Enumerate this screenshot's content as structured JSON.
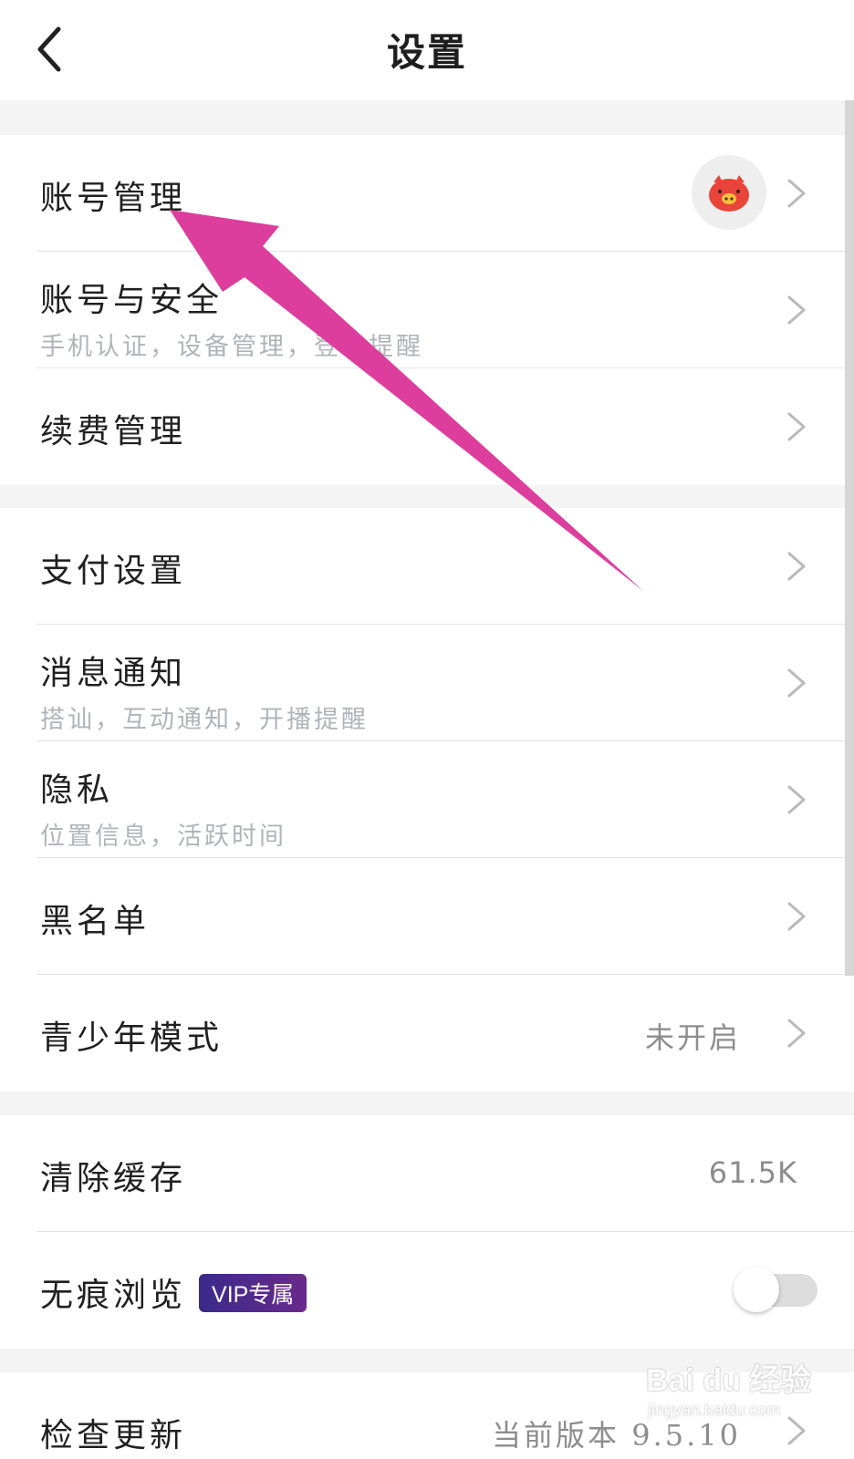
{
  "header": {
    "title": "设置"
  },
  "groups": [
    {
      "items": [
        {
          "title": "账号管理"
        },
        {
          "title": "账号与安全",
          "subtitle": "手机认证，设备管理，登录提醒"
        },
        {
          "title": "续费管理"
        }
      ]
    },
    {
      "items": [
        {
          "title": "支付设置"
        },
        {
          "title": "消息通知",
          "subtitle": "搭讪，互动通知，开播提醒"
        },
        {
          "title": "隐私",
          "subtitle": "位置信息，活跃时间"
        },
        {
          "title": "黑名单"
        },
        {
          "title": "青少年模式",
          "value": "未开启"
        }
      ]
    },
    {
      "items": [
        {
          "title": "清除缓存",
          "value": "61.5K"
        },
        {
          "title": "无痕浏览",
          "badge": "VIP专属",
          "toggle_on": false
        }
      ]
    },
    {
      "items": [
        {
          "title": "检查更新",
          "value": "当前版本 9.5.10"
        }
      ]
    }
  ],
  "watermark": {
    "main": "Bai du 经验",
    "sub": "jingyan.baidu.com"
  },
  "colors": {
    "annotation_arrow": "#dd3d9c",
    "vip_badge_start": "#3a2a8a",
    "vip_badge_end": "#6a2a8c",
    "avatar_accent": "#e8443a"
  },
  "icons": {
    "back": "back-arrow-icon",
    "chevron": "chevron-right-icon",
    "avatar": "pig-avatar-icon"
  }
}
